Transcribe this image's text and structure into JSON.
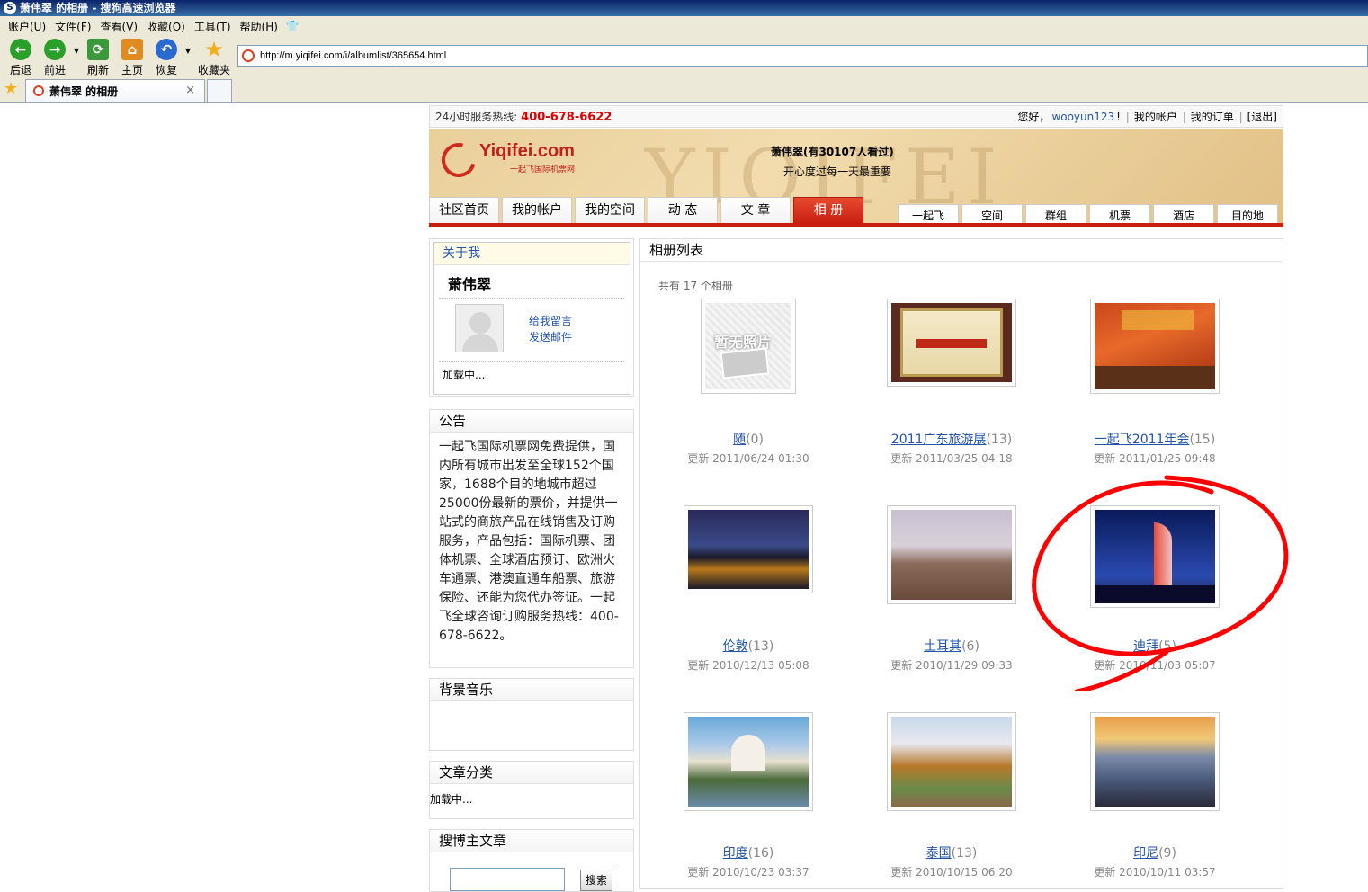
{
  "browser": {
    "title": "萧伟翠 的相册 - 搜狗高速浏览器",
    "menu": [
      "账户(U)",
      "文件(F)",
      "查看(V)",
      "收藏(O)",
      "工具(T)",
      "帮助(H)"
    ],
    "toolbar": {
      "back": "后退",
      "forward": "前进",
      "refresh": "刷新",
      "home": "主页",
      "restore": "恢复",
      "favorites": "收藏夹"
    },
    "url": "http://m.yiqifei.com/i/albumlist/365654.html",
    "tab_title": "萧伟翠 的相册",
    "tab_close": "×"
  },
  "topbar": {
    "hotline_label": "24小时服务热线:",
    "hotline": "400-678-6622",
    "greeting": "您好，",
    "username": "wooyun123",
    "greeting_tail": "!",
    "account": "我的帐户",
    "orders": "我的订单",
    "logout": "[退出]"
  },
  "banner": {
    "brand": "Yiqifei.com",
    "brand_sub": "一起飞国际机票网",
    "owner_title": "萧伟翠(有30107人看过)",
    "motto": "开心度过每一天最重要"
  },
  "nav": {
    "tabs": [
      "社区首页",
      "我的帐户",
      "我的空间",
      "动 态",
      "文 章",
      "相 册"
    ],
    "active_index": 5,
    "subtabs": [
      "一起飞",
      "空间",
      "群组",
      "机票",
      "酒店",
      "目的地"
    ]
  },
  "aboutme": {
    "header": "关于我",
    "name": "萧伟翠",
    "leave_message": "给我留言",
    "send_mail": "发送邮件",
    "loading": "加载中..."
  },
  "notice": {
    "header": "公告",
    "body": "一起飞国际机票网免费提供，国内所有城市出发至全球152个国家，1688个目的地城市超过25000份最新的票价，并提供一站式的商旅产品在线销售及订购服务，产品包括：国际机票、团体机票、全球酒店预订、欧洲火车通票、港澳直通车船票、旅游保险、还能为您代办签证。一起飞全球咨询订购服务热线：400-678-6622。"
  },
  "music": {
    "header": "背景音乐"
  },
  "cats": {
    "header": "文章分类",
    "loading": "加载中..."
  },
  "search": {
    "header": "搜博主文章",
    "button": "搜索"
  },
  "albums": {
    "header": "相册列表",
    "count_text": "共有 17 个相册",
    "no_photo_text": "暂无照片",
    "items": [
      {
        "name": "随",
        "count": "(0)",
        "updated": "更新 2011/06/24 01:30"
      },
      {
        "name": "2011广东旅游展",
        "count": "(13)",
        "updated": "更新 2011/03/25 04:18"
      },
      {
        "name": "一起飞2011年会",
        "count": "(15)",
        "updated": "更新 2011/01/25 09:48"
      },
      {
        "name": "伦敦",
        "count": "(13)",
        "updated": "更新 2010/12/13 05:08"
      },
      {
        "name": "土耳其",
        "count": "(6)",
        "updated": "更新 2010/11/29 09:33"
      },
      {
        "name": "迪拜",
        "count": "(5)",
        "updated": "更新 2010/11/03 05:07"
      },
      {
        "name": "印度",
        "count": "(16)",
        "updated": "更新 2010/10/23 03:37"
      },
      {
        "name": "泰国",
        "count": "(13)",
        "updated": "更新 2010/10/15 06:20"
      },
      {
        "name": "印尼",
        "count": "(9)",
        "updated": "更新 2010/10/11 03:57"
      }
    ]
  },
  "colors": {
    "accent_red": "#c81e10",
    "link_blue": "#2255aa",
    "annotation_red": "#ff0000"
  }
}
